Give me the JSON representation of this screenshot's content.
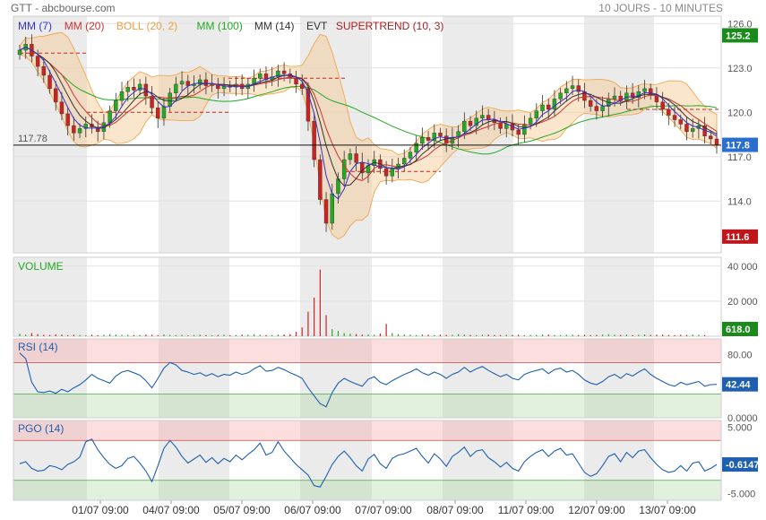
{
  "header": {
    "left": "GTT - abcbourse.com",
    "right": "10 JOURS - 10 MINUTES"
  },
  "legend": [
    {
      "label": "MM (7)",
      "color": "#3333cc"
    },
    {
      "label": "MM (20)",
      "color": "#cc3333"
    },
    {
      "label": "BOLL (20, 2)",
      "color": "#f0a040"
    },
    {
      "label": "MM (100)",
      "color": "#22aa22"
    },
    {
      "label": "MM (14)",
      "color": "#333333"
    },
    {
      "label": "EVT",
      "color": "#333333"
    },
    {
      "label": "SUPERTREND (10, 3)",
      "color": "#aa2222"
    }
  ],
  "chart_data": {
    "type": "candlestick",
    "x_dates": [
      "01/07 09:00",
      "04/07 09:00",
      "05/07 09:00",
      "06/07 09:00",
      "07/07 09:00",
      "08/07 09:00",
      "11/07 09:00",
      "12/07 09:00",
      "13/07 09:00"
    ],
    "price": {
      "ylim": [
        110.5,
        126.5
      ],
      "yticks": [
        126.0,
        123.0,
        120.0,
        117.0,
        114.0
      ],
      "ytick_labels": [
        "126.0",
        "123.0",
        "120.0",
        "117.0",
        "114.0"
      ],
      "reference_line": 117.78,
      "reference_label": "117.78",
      "badges": [
        {
          "value": 125.2,
          "label": "125.2",
          "color": "#1a8a1a"
        },
        {
          "value": 117.8,
          "label": "117.8",
          "color": "#2a6fcf"
        },
        {
          "value": 111.6,
          "label": "111.6",
          "color": "#c0161b"
        }
      ],
      "closes": [
        124.2,
        124.6,
        123.8,
        123.1,
        122.5,
        121.6,
        120.7,
        119.9,
        119.1,
        118.6,
        118.9,
        119.2,
        119.0,
        118.7,
        119.3,
        120.1,
        120.8,
        121.4,
        121.7,
        121.5,
        121.9,
        121.1,
        120.3,
        119.6,
        120.4,
        121.3,
        121.9,
        122.1,
        121.8,
        121.9,
        122.2,
        121.8,
        121.9,
        121.6,
        121.8,
        121.7,
        121.9,
        121.6,
        121.9,
        122.3,
        122.6,
        122.2,
        122.4,
        122.8,
        122.6,
        122.3,
        121.9,
        121.6,
        119.4,
        116.8,
        114.1,
        112.5,
        114.5,
        115.5,
        116.8,
        117.2,
        116.6,
        115.9,
        116.4,
        116.8,
        116.2,
        115.7,
        116.2,
        116.5,
        116.9,
        117.3,
        117.9,
        118.3,
        118.1,
        118.6,
        118.4,
        117.9,
        118.3,
        118.7,
        119.4,
        119.1,
        119.6,
        119.8,
        119.5,
        119.3,
        118.9,
        119.2,
        118.8,
        118.5,
        119.2,
        119.6,
        120.1,
        120.5,
        120.2,
        120.9,
        121.3,
        121.6,
        121.8,
        121.4,
        120.8,
        120.4,
        120.1,
        120.4,
        120.9,
        121.1,
        120.8,
        121.3,
        121.0,
        121.4,
        121.6,
        121.2,
        120.7,
        120.2,
        119.8,
        119.5,
        119.2,
        118.7,
        118.9,
        119.1,
        118.4,
        118.2,
        117.8
      ]
    },
    "volume": {
      "label": "VOLUME",
      "ylim": [
        0,
        45000
      ],
      "yticks": [
        40000,
        20000
      ],
      "ytick_labels": [
        "40 000",
        "20 000"
      ],
      "last_label": "618.0",
      "last_color": "#1a8a1a",
      "values": [
        1400,
        900,
        1800,
        1200,
        800,
        700,
        1100,
        900,
        600,
        800,
        700,
        500,
        900,
        600,
        800,
        1200,
        900,
        700,
        800,
        600,
        700,
        900,
        800,
        600,
        1000,
        700,
        600,
        800,
        500,
        700,
        900,
        600,
        500,
        700,
        800,
        600,
        700,
        900,
        800,
        1100,
        800,
        700,
        600,
        900,
        1000,
        1200,
        2500,
        5000,
        14000,
        22000,
        38000,
        12000,
        4000,
        3000,
        1800,
        1400,
        1200,
        900,
        1000,
        800,
        1500,
        7000,
        1800,
        1200,
        900,
        800,
        700,
        1000,
        800,
        600,
        900,
        700,
        800,
        1200,
        900,
        700,
        600,
        800,
        900,
        700,
        600,
        800,
        700,
        900,
        600,
        700,
        800,
        1000,
        900,
        700,
        600,
        800,
        900,
        700,
        800,
        600,
        700,
        900,
        1100,
        800,
        700,
        900,
        600,
        800,
        1000,
        700,
        800,
        900,
        700,
        600,
        800,
        700,
        900,
        800,
        618
      ]
    },
    "rsi": {
      "label": "RSI (14)",
      "ylim": [
        0,
        100
      ],
      "yticks": [
        80.0,
        0.0
      ],
      "ytick_labels": [
        "80.00",
        "0.0000"
      ],
      "last_label": "42.44",
      "last_color": "#1f5fb0",
      "values": [
        82,
        75,
        45,
        33,
        32,
        34,
        31,
        36,
        33,
        38,
        42,
        48,
        55,
        50,
        47,
        44,
        53,
        58,
        60,
        57,
        54,
        47,
        38,
        50,
        63,
        70,
        67,
        60,
        58,
        55,
        57,
        53,
        56,
        52,
        55,
        54,
        58,
        55,
        57,
        62,
        66,
        59,
        60,
        64,
        61,
        57,
        54,
        50,
        38,
        28,
        18,
        14,
        32,
        44,
        50,
        46,
        43,
        40,
        49,
        52,
        45,
        42,
        47,
        51,
        55,
        58,
        62,
        57,
        54,
        58,
        55,
        50,
        55,
        58,
        64,
        58,
        62,
        65,
        60,
        56,
        52,
        55,
        50,
        48,
        55,
        58,
        60,
        62,
        56,
        61,
        63,
        58,
        60,
        55,
        48,
        44,
        42,
        46,
        52,
        55,
        50,
        56,
        53,
        58,
        62,
        55,
        50,
        46,
        42,
        40,
        45,
        42,
        44,
        46,
        40,
        42,
        42.44
      ]
    },
    "pgo": {
      "label": "PGO (14)",
      "ylim": [
        -6,
        6
      ],
      "yticks": [
        5.0,
        -5.0
      ],
      "ytick_labels": [
        "5.000",
        "-5.000"
      ],
      "last_label": "-0.6147",
      "last_color": "#1f5fb0",
      "values": [
        -0.5,
        -0.2,
        -1.2,
        -1.6,
        -1.5,
        -0.8,
        -1.0,
        -1.4,
        -0.6,
        -0.2,
        0.5,
        2.8,
        3.2,
        1.6,
        0.4,
        -0.6,
        -1.2,
        -0.8,
        0.3,
        0.6,
        -0.4,
        -1.6,
        -3.2,
        -0.8,
        1.8,
        3.0,
        2.0,
        0.6,
        -0.4,
        0.2,
        0.8,
        -0.3,
        0.4,
        -0.5,
        0.3,
        -0.2,
        0.8,
        0.1,
        0.9,
        1.6,
        2.6,
        0.8,
        1.2,
        2.8,
        1.4,
        0.4,
        -0.6,
        -1.4,
        -2.2,
        -3.8,
        -4.0,
        -2.4,
        -0.6,
        0.6,
        1.4,
        0.4,
        -0.8,
        -1.6,
        0.2,
        0.9,
        -0.5,
        -1.2,
        0.3,
        0.8,
        1.0,
        1.4,
        1.8,
        0.6,
        -0.4,
        1.0,
        0.2,
        -0.9,
        0.6,
        1.2,
        2.0,
        0.6,
        1.4,
        1.6,
        0.4,
        -0.2,
        -1.0,
        -0.3,
        -1.2,
        -1.6,
        -0.2,
        0.6,
        1.2,
        1.6,
        0.6,
        1.4,
        1.8,
        0.8,
        1.0,
        -0.4,
        -1.8,
        -2.4,
        -2.0,
        -0.8,
        0.6,
        1.0,
        -0.2,
        1.2,
        0.4,
        1.4,
        1.6,
        0.4,
        -0.6,
        -1.4,
        -1.8,
        -1.6,
        -0.8,
        -1.6,
        -0.4,
        -0.2,
        -1.6,
        -1.2,
        -0.6147
      ]
    }
  }
}
